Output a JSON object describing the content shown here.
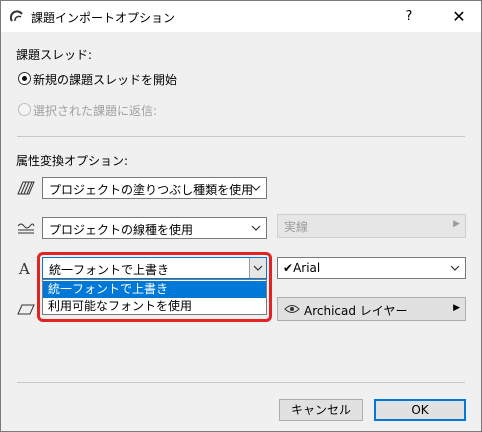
{
  "window": {
    "title": "課題インポートオプション",
    "help_label": "?",
    "close_label": "✕"
  },
  "thread_section": {
    "label": "課題スレッド:",
    "options": [
      {
        "label": "新規の課題スレッドを開始",
        "checked": true,
        "enabled": true
      },
      {
        "label": "選択された課題に返信:",
        "checked": false,
        "enabled": false
      }
    ]
  },
  "attribute_section": {
    "label": "属性変換オプション:",
    "fill": {
      "icon": "fill-pattern-icon",
      "value": "プロジェクトの塗りつぶし種類を使用"
    },
    "line": {
      "icon": "line-type-icon",
      "value": "プロジェクトの線種を使用",
      "side_value": "実線"
    },
    "font": {
      "icon": "font-icon",
      "value": "統一フォントで上書き",
      "side_value": "Arial",
      "side_prefix": "✔"
    },
    "layer": {
      "icon": "layer-icon",
      "side_value": "Archicad レイヤー"
    },
    "font_dropdown": {
      "options": [
        {
          "label": "統一フォントで上書き",
          "selected": true
        },
        {
          "label": "利用可能なフォントを使用",
          "selected": false
        }
      ]
    }
  },
  "footer": {
    "cancel_label": "キャンセル",
    "ok_label": "OK"
  },
  "colors": {
    "accent": "#0078d7",
    "highlight": "#e32222"
  }
}
